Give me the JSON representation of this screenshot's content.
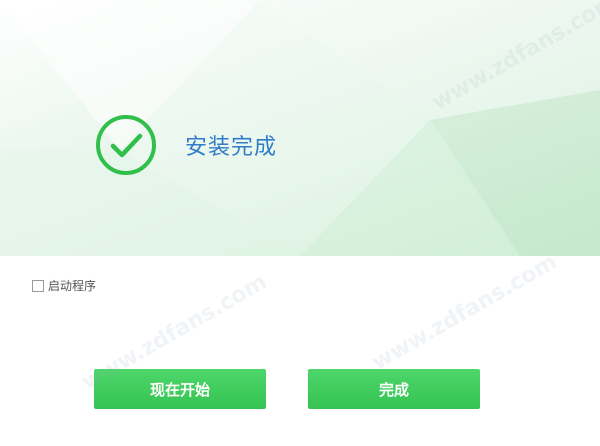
{
  "status": {
    "title": "安装完成",
    "icon": "check-circle-icon",
    "accent_color": "#2fbf4a",
    "title_color": "#2f7cc8"
  },
  "options": {
    "launch_label": "启动程序",
    "launch_checked": false
  },
  "buttons": {
    "start_label": "现在开始",
    "finish_label": "完成",
    "color": "#3dcb5a"
  },
  "watermark": {
    "text": "www.zdfans.com"
  }
}
